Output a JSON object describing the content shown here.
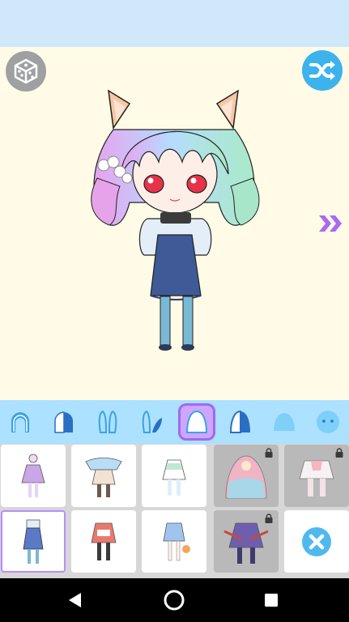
{
  "icons": {
    "random_3d": "cube-dice-icon",
    "shuffle": "shuffle-icon",
    "next": "double-chevron-right-icon",
    "remove": "close-icon",
    "lock": "lock-icon"
  },
  "categories": [
    {
      "id": "hair-front",
      "icon": "hair-front-icon",
      "selected": false
    },
    {
      "id": "hair-back",
      "icon": "hair-back-icon",
      "selected": false
    },
    {
      "id": "ears",
      "icon": "bunny-ears-icon",
      "selected": false
    },
    {
      "id": "ears-alt",
      "icon": "bunny-ears-alt-icon",
      "selected": false
    },
    {
      "id": "outfit",
      "icon": "outfit-icon",
      "selected": true
    },
    {
      "id": "outfit-alt",
      "icon": "outfit-alt-icon",
      "selected": false
    },
    {
      "id": "body",
      "icon": "body-icon",
      "selected": false
    },
    {
      "id": "face",
      "icon": "face-icon",
      "selected": false
    }
  ],
  "items": [
    {
      "locked": false,
      "selected": false,
      "color": "#caa6e6"
    },
    {
      "locked": false,
      "selected": false,
      "color": "#b9ddf4"
    },
    {
      "locked": false,
      "selected": false,
      "color": "#bfe8d4"
    },
    {
      "locked": true,
      "selected": false,
      "color": "#f0b4c4"
    },
    {
      "locked": true,
      "selected": false,
      "color": "#f6b6bb"
    },
    {
      "locked": false,
      "selected": true,
      "color": "#5a79c7"
    },
    {
      "locked": false,
      "selected": false,
      "color": "#e9796e"
    },
    {
      "locked": false,
      "selected": false,
      "color": "#9fc5ef"
    },
    {
      "locked": true,
      "selected": false,
      "color": "#6d5fae"
    },
    {
      "locked": false,
      "selected": false,
      "remove": true
    }
  ],
  "colors": {
    "accent": "#3cb3ec",
    "selected": "#b88cff",
    "category_bar": "#ace1ff"
  }
}
